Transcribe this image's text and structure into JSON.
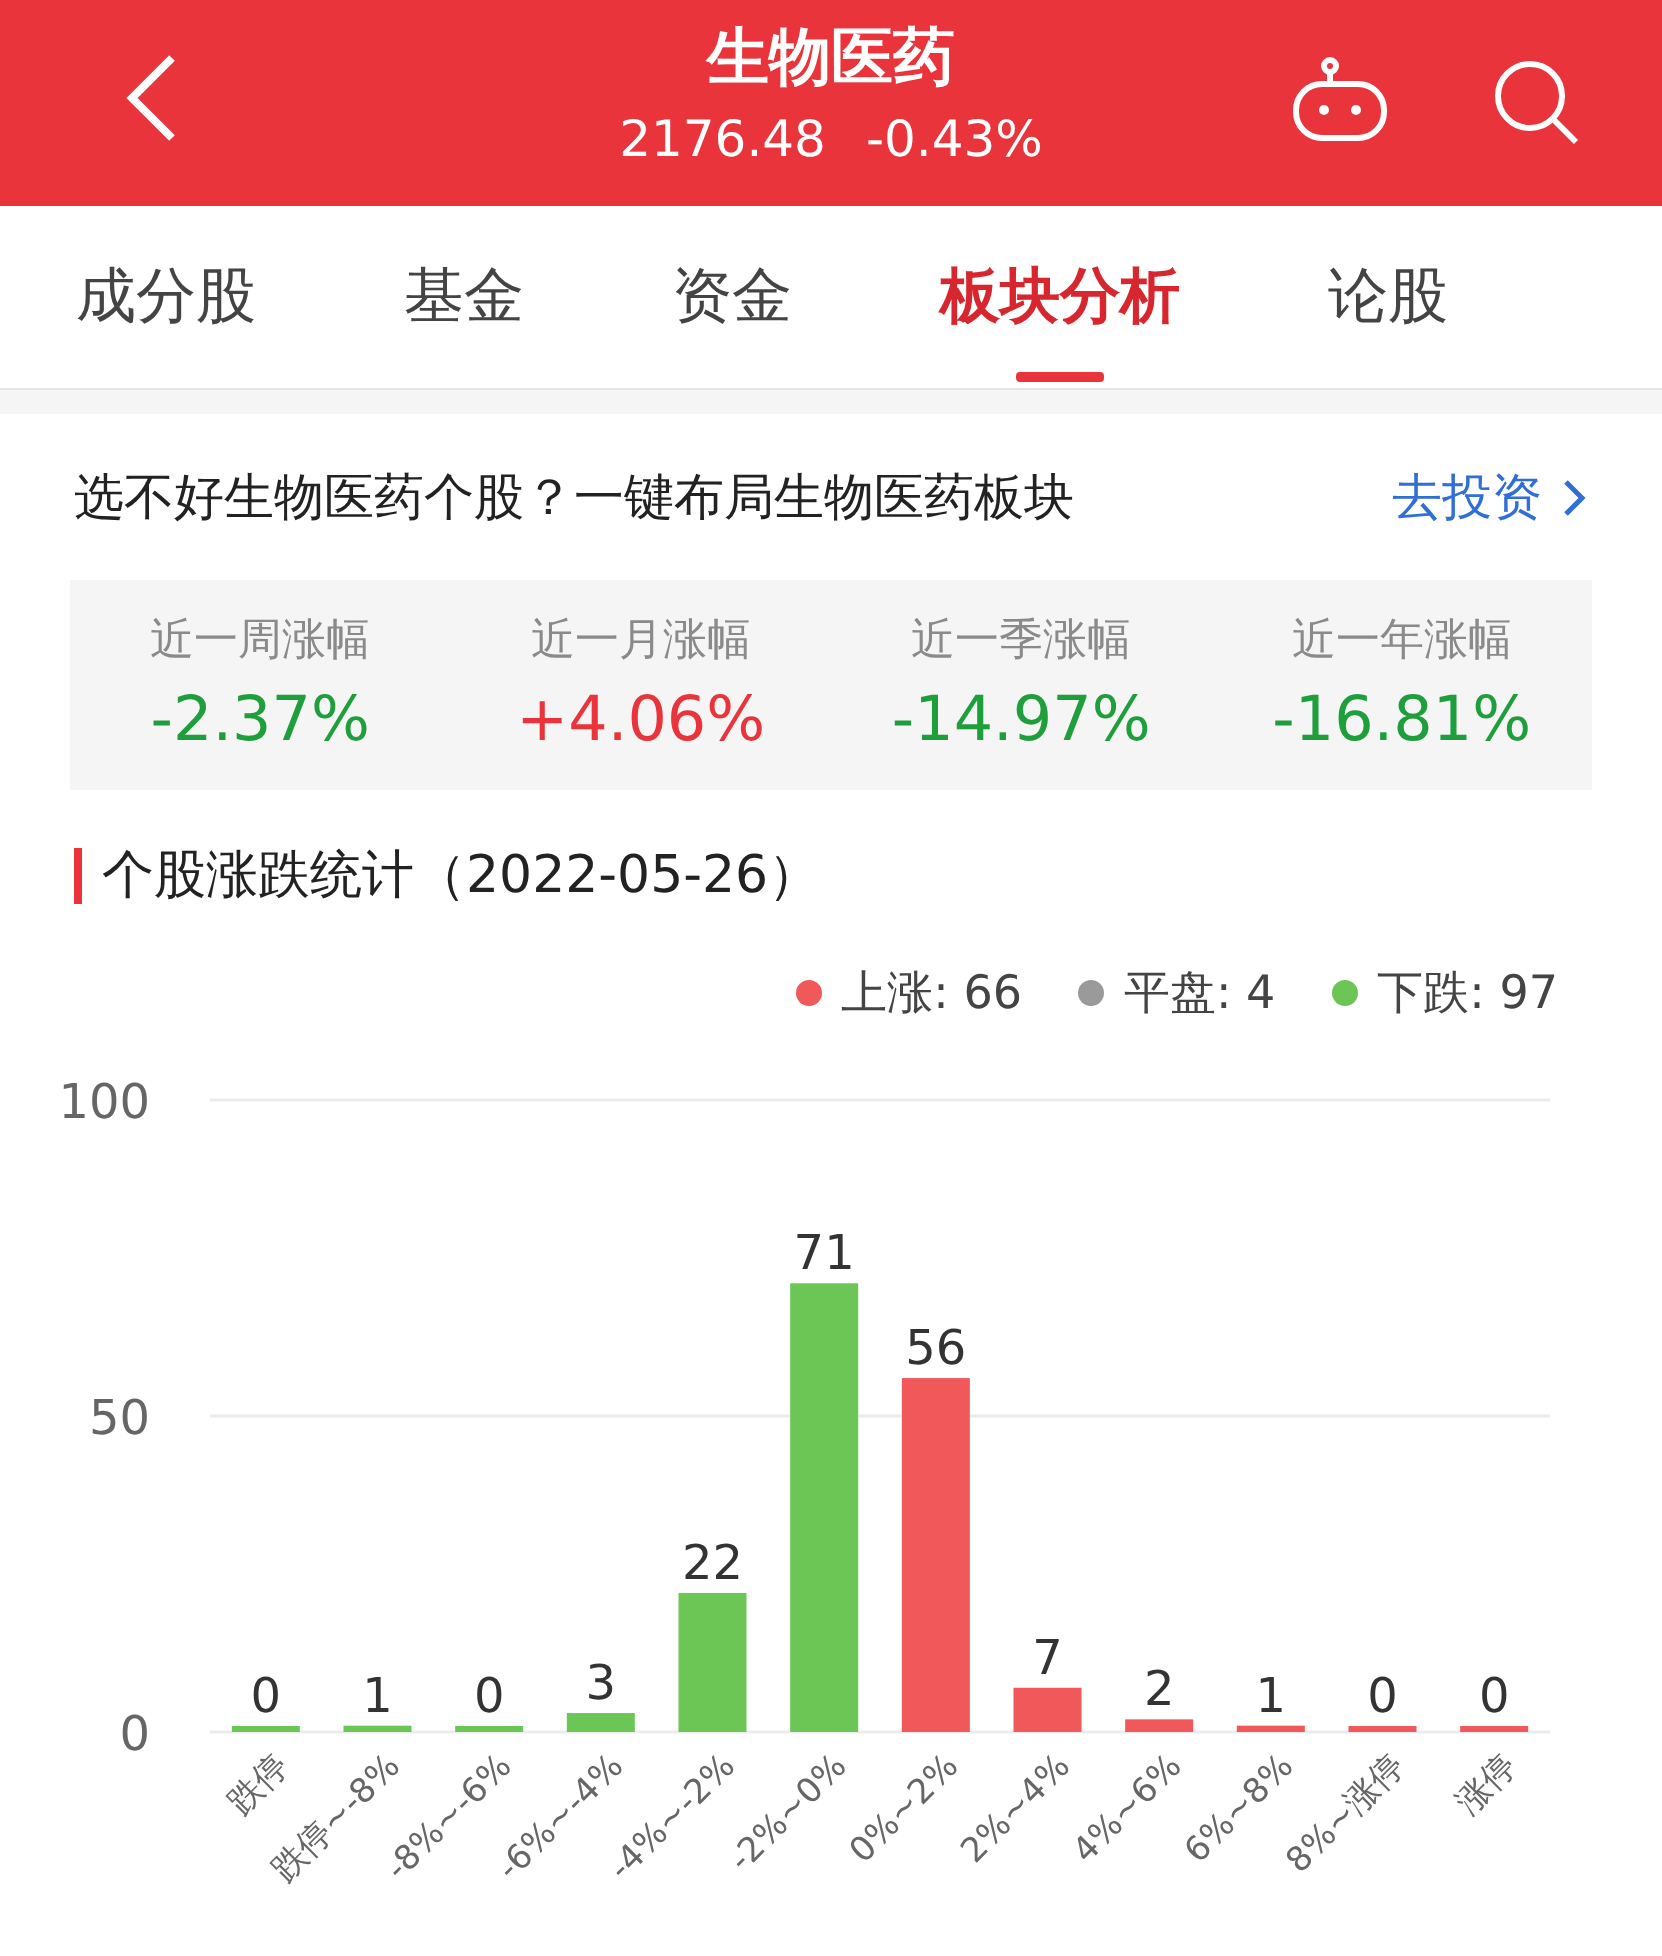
{
  "header": {
    "title": "生物医药",
    "price": "2176.48",
    "change": "-0.43%"
  },
  "tabs": [
    {
      "label": "成分股",
      "selected": false
    },
    {
      "label": "基金",
      "selected": false
    },
    {
      "label": "资金",
      "selected": false
    },
    {
      "label": "板块分析",
      "selected": true
    },
    {
      "label": "论股",
      "selected": false
    }
  ],
  "promo": {
    "text": "选不好生物医药个股？一键布局生物医药板块",
    "link": "去投资"
  },
  "returns": [
    {
      "label": "近一周涨幅",
      "value": "-2.37%",
      "color": "#1f9e3c"
    },
    {
      "label": "近一月涨幅",
      "value": "+4.06%",
      "color": "#e8343a"
    },
    {
      "label": "近一季涨幅",
      "value": "-14.97%",
      "color": "#1f9e3c"
    },
    {
      "label": "近一年涨幅",
      "value": "-16.81%",
      "color": "#1f9e3c"
    }
  ],
  "section": {
    "title": "个股涨跌统计（2022-05-26）"
  },
  "legend": [
    {
      "label": "上涨: 66",
      "color": "#f0585a"
    },
    {
      "label": "平盘: 4",
      "color": "#9a9a9a"
    },
    {
      "label": "下跌: 97",
      "color": "#6cc655"
    }
  ],
  "chart_data": {
    "type": "bar",
    "categories": [
      "跌停",
      "跌停~-8%",
      "-8%~-6%",
      "-6%~-4%",
      "-4%~-2%",
      "-2%~0%",
      "0%~2%",
      "2%~4%",
      "4%~6%",
      "6%~8%",
      "8%~涨停",
      "涨停"
    ],
    "series": [
      {
        "color": "#6cc655",
        "values": [
          0,
          1,
          0,
          3,
          22,
          71,
          null,
          null,
          null,
          null,
          null,
          null
        ]
      },
      {
        "color": "#f0585a",
        "values": [
          null,
          null,
          null,
          null,
          null,
          null,
          56,
          7,
          2,
          1,
          0,
          0
        ]
      }
    ],
    "ylim": [
      0,
      100
    ],
    "yticks": [
      0,
      50,
      100
    ],
    "data_labels": true
  }
}
